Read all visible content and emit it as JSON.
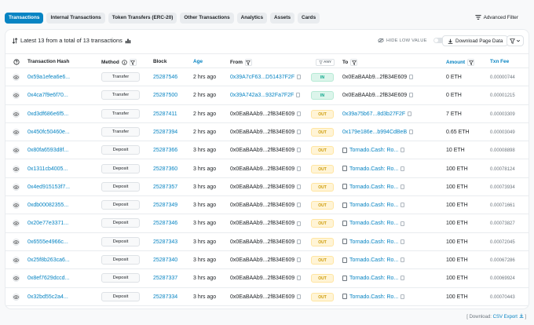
{
  "tabs": [
    {
      "label": "Transactions",
      "active": true
    },
    {
      "label": "Internal Transactions",
      "active": false
    },
    {
      "label": "Token Transfers (ERC-20)",
      "active": false
    },
    {
      "label": "Other Transactions",
      "active": false
    },
    {
      "label": "Analytics",
      "active": false
    },
    {
      "label": "Assets",
      "active": false
    },
    {
      "label": "Cards",
      "active": false
    }
  ],
  "advanced_filter_label": "Advanced Filter",
  "summary_text": "Latest 13 from a total of 13 transactions",
  "hide_low_value_label": "HIDE LOW VALUE",
  "download_page_data_label": "Download Page Data",
  "columns": {
    "hash": "Transaction Hash",
    "method": "Method",
    "block": "Block",
    "age": "Age",
    "from": "From",
    "any": "ANY",
    "to": "To",
    "amount": "Amount",
    "fee": "Txn Fee"
  },
  "rows": [
    {
      "hash": "0x59a1efea6e6...",
      "method": "Transfer",
      "block": "25287546",
      "age": "2 hrs ago",
      "from": "0x39A7cF63...D51437F2F",
      "from_link": true,
      "dir": "IN",
      "to": "0x0EaBAAb9...2fB34E609",
      "to_link": false,
      "to_contract": false,
      "amount": "0 ETH",
      "fee": "0.00000744"
    },
    {
      "hash": "0x4ca7f9e6f70...",
      "method": "Transfer",
      "block": "25287500",
      "age": "2 hrs ago",
      "from": "0x39A742a3...932Fa7F2F",
      "from_link": true,
      "dir": "IN",
      "to": "0x0EaBAAb9...2fB34E609",
      "to_link": false,
      "to_contract": false,
      "amount": "0 ETH",
      "fee": "0.00001215"
    },
    {
      "hash": "0xd3df686e6f5...",
      "method": "Transfer",
      "block": "25287411",
      "age": "2 hrs ago",
      "from": "0x0EaBAAb9...2fB34E609",
      "from_link": false,
      "dir": "OUT",
      "to": "0x39a75b67...8d3b27F2F",
      "to_link": true,
      "to_contract": false,
      "amount": "7 ETH",
      "fee": "0.00003309"
    },
    {
      "hash": "0x450fc50460e...",
      "method": "Transfer",
      "block": "25287394",
      "age": "2 hrs ago",
      "from": "0x0EaBAAb9...2fB34E609",
      "from_link": false,
      "dir": "OUT",
      "to": "0x179e186e...b994CdBeB",
      "to_link": true,
      "to_contract": false,
      "amount": "0.65 ETH",
      "fee": "0.00003049"
    },
    {
      "hash": "0x80fa6593d8f...",
      "method": "Deposit",
      "block": "25287366",
      "age": "3 hrs ago",
      "from": "0x0EaBAAb9...2fB34E609",
      "from_link": false,
      "dir": "OUT",
      "to": "Tornado.Cash: Ro...",
      "to_link": true,
      "to_contract": true,
      "amount": "10 ETH",
      "fee": "0.00008898"
    },
    {
      "hash": "0x1311cb4005...",
      "method": "Deposit",
      "block": "25287360",
      "age": "3 hrs ago",
      "from": "0x0EaBAAb9...2fB34E609",
      "from_link": false,
      "dir": "OUT",
      "to": "Tornado.Cash: Ro...",
      "to_link": true,
      "to_contract": true,
      "amount": "100 ETH",
      "fee": "0.00078124"
    },
    {
      "hash": "0x4ed915153f7...",
      "method": "Deposit",
      "block": "25287357",
      "age": "3 hrs ago",
      "from": "0x0EaBAAb9...2fB34E609",
      "from_link": false,
      "dir": "OUT",
      "to": "Tornado.Cash: Ro...",
      "to_link": true,
      "to_contract": true,
      "amount": "100 ETH",
      "fee": "0.00073934"
    },
    {
      "hash": "0xdb00082355...",
      "method": "Deposit",
      "block": "25287349",
      "age": "3 hrs ago",
      "from": "0x0EaBAAb9...2fB34E609",
      "from_link": false,
      "dir": "OUT",
      "to": "Tornado.Cash: Ro...",
      "to_link": true,
      "to_contract": true,
      "amount": "100 ETH",
      "fee": "0.00071661"
    },
    {
      "hash": "0x20e77e3371...",
      "method": "Deposit",
      "block": "25287346",
      "age": "3 hrs ago",
      "from": "0x0EaBAAb9...2fB34E609",
      "from_link": false,
      "dir": "OUT",
      "to": "Tornado.Cash: Ro...",
      "to_link": true,
      "to_contract": true,
      "amount": "100 ETH",
      "fee": "0.00073827"
    },
    {
      "hash": "0x6555e4966c...",
      "method": "Deposit",
      "block": "25287343",
      "age": "3 hrs ago",
      "from": "0x0EaBAAb9...2fB34E609",
      "from_link": false,
      "dir": "OUT",
      "to": "Tornado.Cash: Ro...",
      "to_link": true,
      "to_contract": true,
      "amount": "100 ETH",
      "fee": "0.00072045"
    },
    {
      "hash": "0x25f8b263ca6...",
      "method": "Deposit",
      "block": "25287340",
      "age": "3 hrs ago",
      "from": "0x0EaBAAb9...2fB34E609",
      "from_link": false,
      "dir": "OUT",
      "to": "Tornado.Cash: Ro...",
      "to_link": true,
      "to_contract": true,
      "amount": "100 ETH",
      "fee": "0.00067286"
    },
    {
      "hash": "0x8ef7629dccd...",
      "method": "Deposit",
      "block": "25287337",
      "age": "3 hrs ago",
      "from": "0x0EaBAAb9...2fB34E609",
      "from_link": false,
      "dir": "OUT",
      "to": "Tornado.Cash: Ro...",
      "to_link": true,
      "to_contract": true,
      "amount": "100 ETH",
      "fee": "0.00069924"
    },
    {
      "hash": "0x32bd55c2a4...",
      "method": "Deposit",
      "block": "25287334",
      "age": "3 hrs ago",
      "from": "0x0EaBAAb9...2fB34E609",
      "from_link": false,
      "dir": "OUT",
      "to": "Tornado.Cash: Ro...",
      "to_link": true,
      "to_contract": true,
      "amount": "100 ETH",
      "fee": "0.00070443"
    }
  ],
  "footer": {
    "prefix": "[ Download:",
    "link": "CSV Export",
    "suffix": "]"
  },
  "colors": {
    "accent": "#0784c3",
    "in_badge": "#00a186",
    "out_badge": "#cc9a06"
  },
  "icons": [
    "filter-icon",
    "sort-icon",
    "eye-icon",
    "copy-icon",
    "download-icon",
    "contract-icon",
    "chart-icon",
    "help-icon"
  ]
}
